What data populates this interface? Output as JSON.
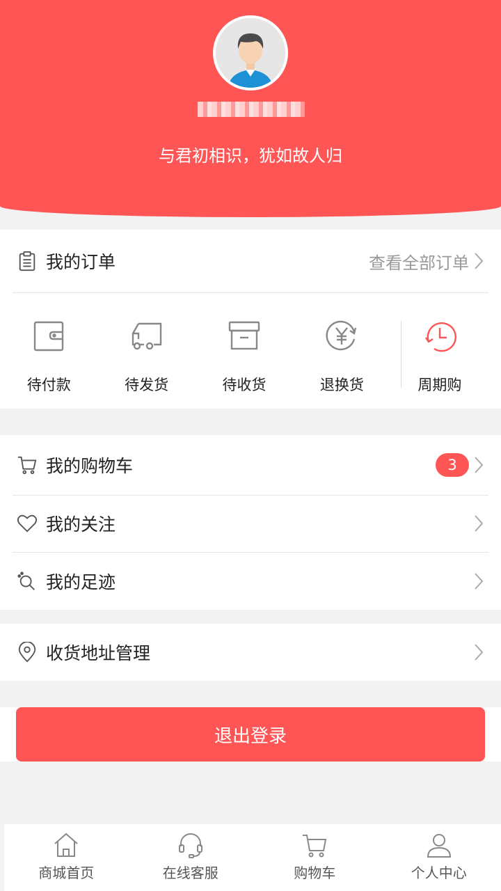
{
  "profile": {
    "username_redacted": "",
    "motto": "与君初相识，犹如故人归"
  },
  "orders": {
    "title": "我的订单",
    "view_all": "查看全部订单",
    "items": [
      {
        "label": "待付款",
        "icon": "wallet-icon"
      },
      {
        "label": "待发货",
        "icon": "truck-icon"
      },
      {
        "label": "待收货",
        "icon": "box-icon"
      },
      {
        "label": "退换货",
        "icon": "yen-refund-icon"
      },
      {
        "label": "周期购",
        "icon": "clock-icon"
      }
    ]
  },
  "menu": {
    "cart": {
      "label": "我的购物车",
      "badge": "3"
    },
    "follow": {
      "label": "我的关注"
    },
    "footprint": {
      "label": "我的足迹"
    },
    "address": {
      "label": "收货地址管理"
    }
  },
  "logout_label": "退出登录",
  "tabs": [
    {
      "label": "商城首页",
      "icon": "home-icon"
    },
    {
      "label": "在线客服",
      "icon": "headset-icon"
    },
    {
      "label": "购物车",
      "icon": "cart-icon"
    },
    {
      "label": "个人中心",
      "icon": "user-icon"
    }
  ],
  "colors": {
    "accent": "#ff5555",
    "background": "#f2f2f2",
    "icon_gray": "#888888"
  }
}
